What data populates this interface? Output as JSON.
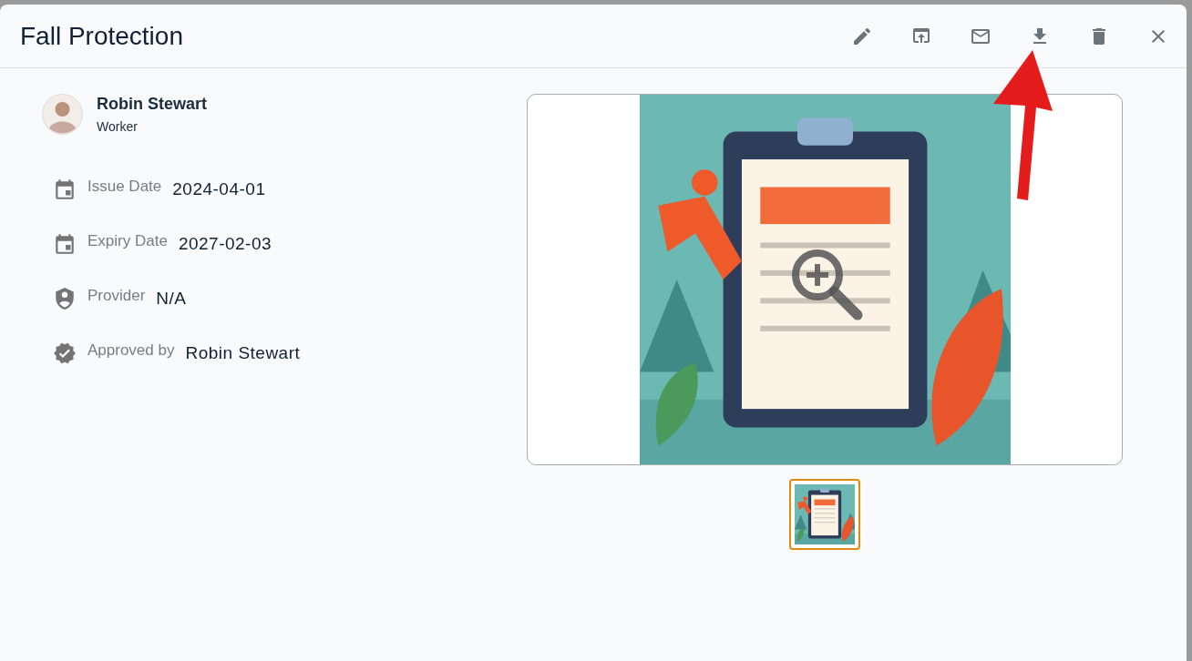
{
  "dialog": {
    "title": "Fall Protection"
  },
  "toolbar": [
    {
      "kind": "edit"
    },
    {
      "kind": "share"
    },
    {
      "kind": "email"
    },
    {
      "kind": "download"
    },
    {
      "kind": "delete"
    },
    {
      "kind": "close"
    }
  ],
  "person": {
    "name": "Robin Stewart",
    "role": "Worker"
  },
  "details": [
    {
      "kind": "calendar",
      "label": "Issue Date",
      "value": "2024-04-01"
    },
    {
      "kind": "calendar",
      "label": "Expiry Date",
      "value": "2027-02-03"
    },
    {
      "kind": "shield",
      "label": "Provider",
      "value": "N/A"
    },
    {
      "kind": "verified",
      "label": "Approved by",
      "value": "Robin Stewart"
    }
  ],
  "viewer": {
    "thumbnails": [
      {
        "kind": "picture",
        "selected": true
      }
    ]
  }
}
